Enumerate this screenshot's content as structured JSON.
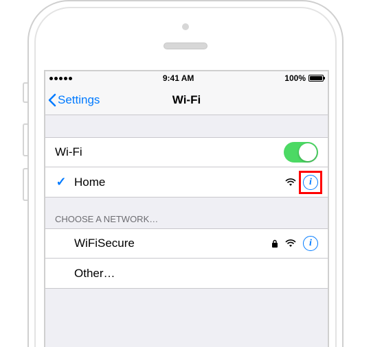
{
  "status_bar": {
    "time": "9:41 AM",
    "battery_pct": "100%"
  },
  "nav": {
    "back_label": "Settings",
    "title": "Wi-Fi"
  },
  "wifi_row": {
    "label": "Wi-Fi"
  },
  "connected": {
    "name": "Home"
  },
  "section_header": "Choose a Network…",
  "networks": [
    {
      "name": "WiFiSecure",
      "locked": true
    }
  ],
  "other_label": "Other…"
}
